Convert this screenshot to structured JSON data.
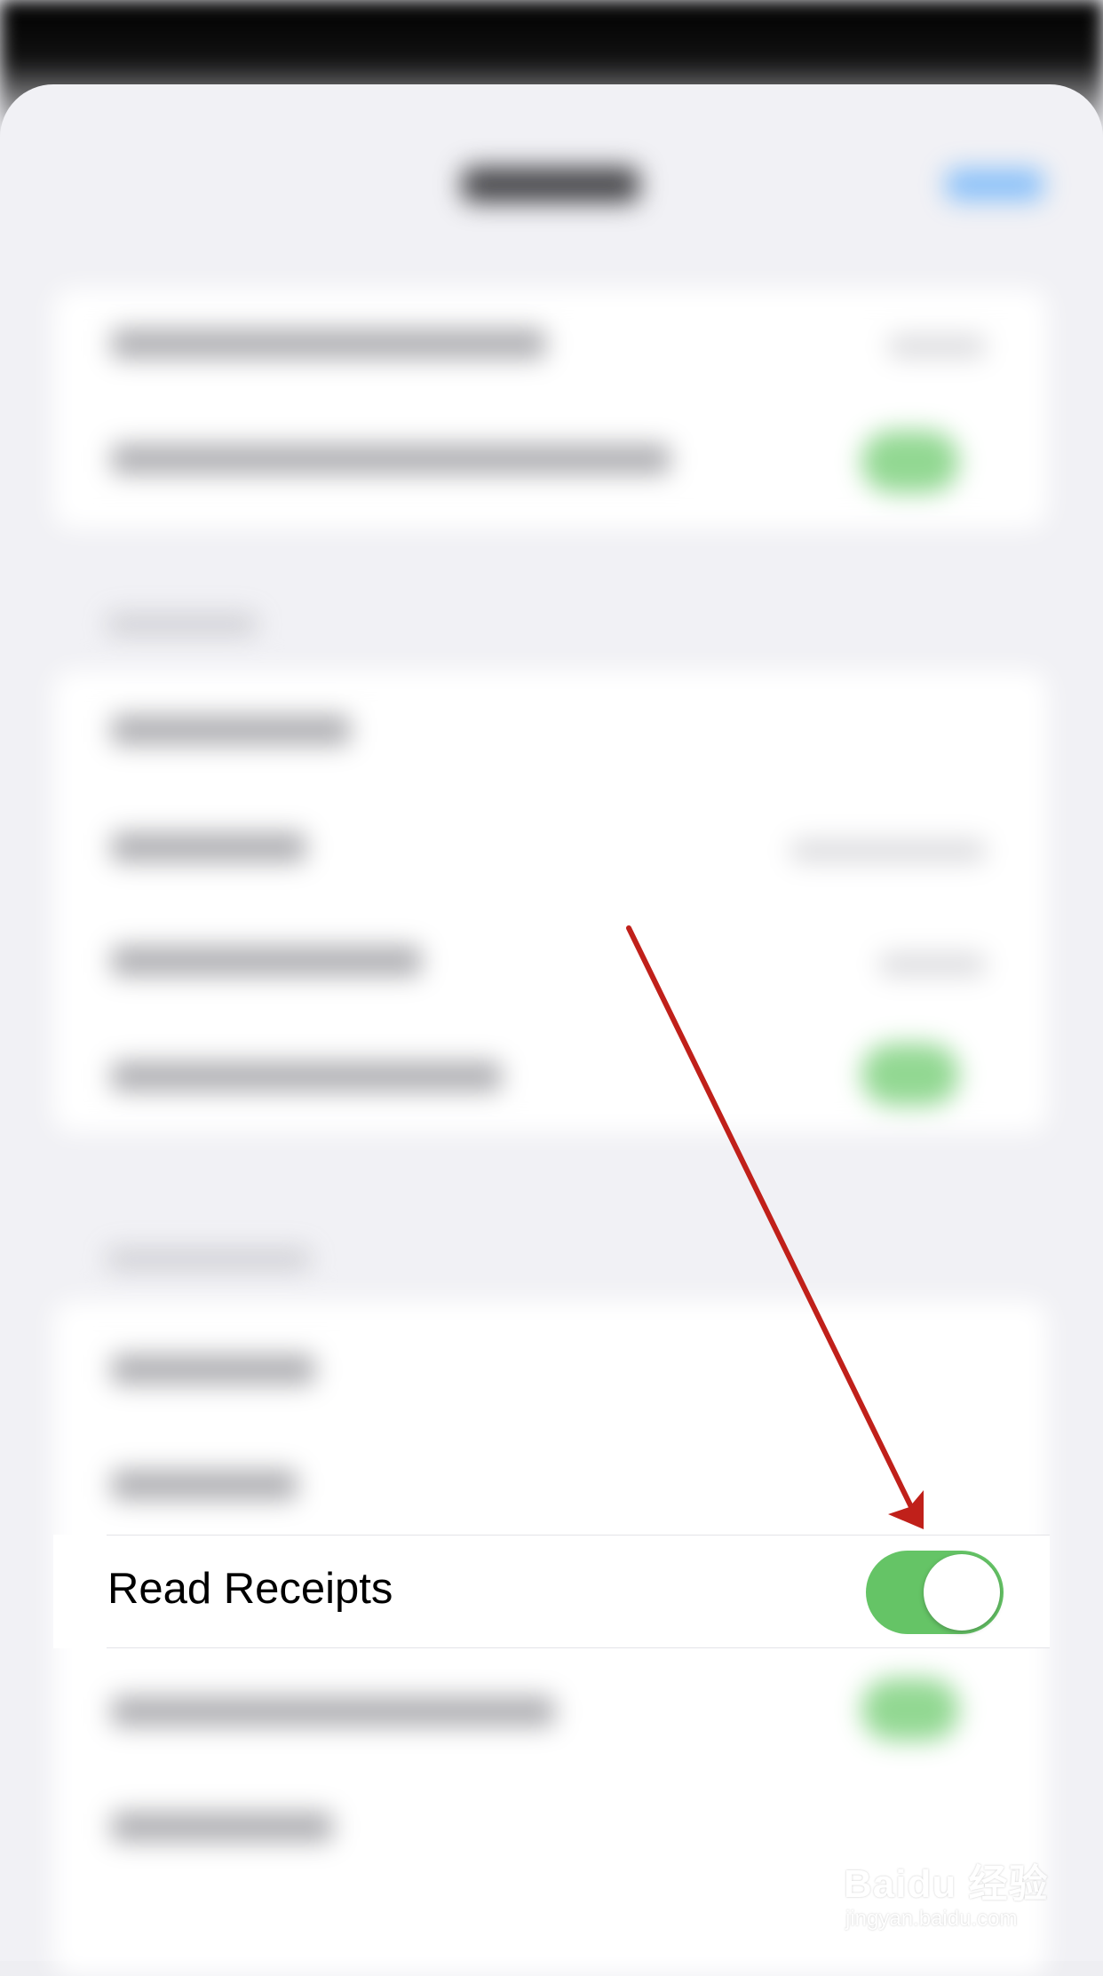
{
  "settings": {
    "read_receipts": {
      "label": "Read Receipts",
      "enabled": true
    }
  },
  "colors": {
    "toggle_on": "#65c466",
    "annotation_arrow": "#c0201a"
  },
  "watermark": {
    "brand": "Baidu 经验",
    "url": "jingyan.baidu.com"
  }
}
